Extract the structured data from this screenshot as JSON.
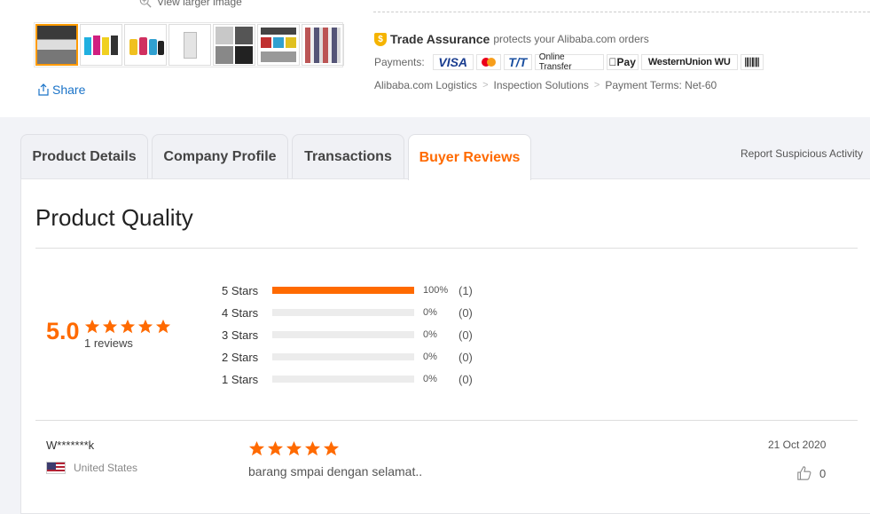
{
  "gallery": {
    "view_larger": "View larger image",
    "share_label": "Share"
  },
  "trade": {
    "title": "Trade Assurance",
    "tail": "protects your Alibaba.com orders",
    "shield_glyph": "$"
  },
  "payments": {
    "label": "Payments:",
    "methods": {
      "visa": "VISA",
      "tt": "T/T",
      "online": "Online Transfer",
      "applepay": "Pay",
      "wu": "WesternUnion WU",
      "boleto": "Boleto"
    }
  },
  "logistics": {
    "items": [
      "Alibaba.com Logistics",
      "Inspection Solutions",
      "Payment Terms: Net-60"
    ],
    "separator": ">"
  },
  "tabs": {
    "product_details": "Product Details",
    "company_profile": "Company Profile",
    "transactions": "Transactions",
    "buyer_reviews": "Buyer Reviews",
    "report": "Report Suspicious Activity"
  },
  "quality": {
    "heading": "Product Quality",
    "score": "5.0",
    "reviews": "1 reviews",
    "distribution": [
      {
        "label": "5  Stars",
        "pct": "100%",
        "fraction": 1.0,
        "count": "(1)"
      },
      {
        "label": "4  Stars",
        "pct": "0%",
        "fraction": 0.0,
        "count": "(0)"
      },
      {
        "label": "3  Stars",
        "pct": "0%",
        "fraction": 0.0,
        "count": "(0)"
      },
      {
        "label": "2  Stars",
        "pct": "0%",
        "fraction": 0.0,
        "count": "(0)"
      },
      {
        "label": "1  Stars",
        "pct": "0%",
        "fraction": 0.0,
        "count": "(0)"
      }
    ]
  },
  "review": {
    "name": "W*******k",
    "country": "United States",
    "rating": 5,
    "text": "barang smpai dengan selamat..",
    "date": "21 Oct 2020",
    "likes": "0"
  },
  "colors": {
    "accent": "#ff6a00",
    "link": "#1a73c8"
  }
}
